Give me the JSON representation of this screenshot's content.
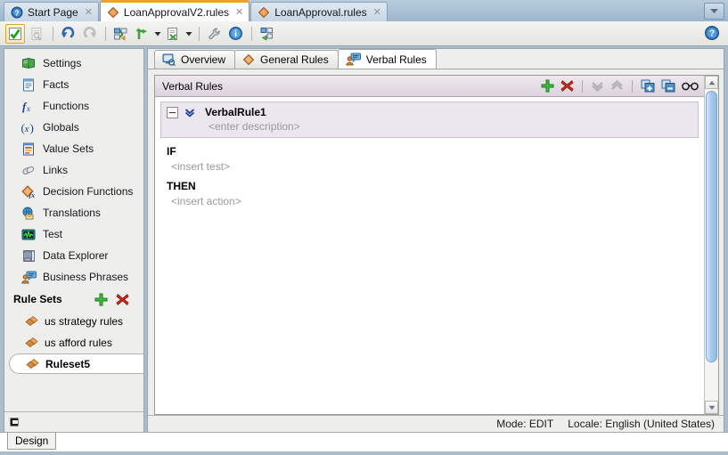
{
  "window": {
    "editor_tabs": [
      {
        "label": "Start Page",
        "icon": "help-circle-icon",
        "active": false,
        "closable": true
      },
      {
        "label": "LoanApprovalV2.rules",
        "icon": "rules-diamond-icon",
        "active": true,
        "closable": true
      },
      {
        "label": "LoanApproval.rules",
        "icon": "rules-diamond-icon",
        "active": false,
        "closable": true
      }
    ],
    "overflow_icon": "chevron-down-icon"
  },
  "toolbar": {
    "buttons": [
      {
        "name": "validate-button",
        "icon": "green-check-icon",
        "selected": true,
        "enabled": true
      },
      {
        "name": "print-preview-button",
        "icon": "document-search-icon",
        "selected": false,
        "enabled": false
      },
      {
        "name": "undo-button",
        "icon": "undo-arrow-icon",
        "selected": false,
        "enabled": true
      },
      {
        "name": "redo-button",
        "icon": "redo-arrow-icon",
        "selected": false,
        "enabled": false
      },
      {
        "name": "dictionary-button",
        "icon": "dictionary-icon",
        "selected": false,
        "enabled": true
      },
      {
        "name": "link-button",
        "icon": "green-branch-icon",
        "selected": false,
        "enabled": true,
        "has_dropdown": true
      },
      {
        "name": "export-button",
        "icon": "document-export-icon",
        "selected": false,
        "enabled": true,
        "has_dropdown": true
      },
      {
        "name": "settings-button",
        "icon": "wrench-icon",
        "selected": false,
        "enabled": true
      },
      {
        "name": "info-button",
        "icon": "info-circle-icon",
        "selected": false,
        "enabled": true
      },
      {
        "name": "goto-button",
        "icon": "green-arrow-dictionary-icon",
        "selected": false,
        "enabled": true
      }
    ],
    "help_icon": "help-circle-icon"
  },
  "sidebar": {
    "nav_items": [
      {
        "label": "Settings",
        "icon": "settings-book-icon"
      },
      {
        "label": "Facts",
        "icon": "facts-document-icon"
      },
      {
        "label": "Functions",
        "icon": "fx-function-icon"
      },
      {
        "label": "Globals",
        "icon": "globals-variable-icon"
      },
      {
        "label": "Value Sets",
        "icon": "value-sets-icon"
      },
      {
        "label": "Links",
        "icon": "links-icon"
      },
      {
        "label": "Decision Functions",
        "icon": "decision-functions-icon"
      },
      {
        "label": "Translations",
        "icon": "translations-icon"
      },
      {
        "label": "Test",
        "icon": "test-monitor-icon"
      },
      {
        "label": "Data Explorer",
        "icon": "data-explorer-icon"
      },
      {
        "label": "Business Phrases",
        "icon": "business-phrases-icon"
      }
    ],
    "rulesets": {
      "header": "Rule Sets",
      "add_icon": "green-plus-icon",
      "delete_icon": "red-x-icon",
      "items": [
        {
          "label": "us strategy rules",
          "icon": "ruleset-diamond-icon",
          "selected": false
        },
        {
          "label": "us afford rules",
          "icon": "ruleset-diamond-icon",
          "selected": false
        },
        {
          "label": "Ruleset5",
          "icon": "ruleset-diamond-icon",
          "selected": true
        }
      ]
    },
    "footer_icon": "collapse-marker-icon"
  },
  "content": {
    "tabs": [
      {
        "label": "Overview",
        "icon": "overview-icon",
        "active": false
      },
      {
        "label": "General Rules",
        "icon": "general-rules-diamond-icon",
        "active": false
      },
      {
        "label": "Verbal Rules",
        "icon": "verbal-rules-icon",
        "active": true
      }
    ],
    "panel": {
      "title": "Verbal Rules",
      "actions": [
        {
          "name": "add-rule-button",
          "icon": "green-plus-icon",
          "enabled": true
        },
        {
          "name": "delete-rule-button",
          "icon": "red-x-icon",
          "enabled": true
        },
        {
          "name": "move-down-button",
          "icon": "chevron-down-icon",
          "enabled": false
        },
        {
          "name": "move-up-button",
          "icon": "chevron-up-icon",
          "enabled": false
        },
        {
          "name": "expand-all-button",
          "icon": "expand-plus-icon",
          "enabled": true
        },
        {
          "name": "collapse-all-button",
          "icon": "collapse-minus-icon",
          "enabled": true
        },
        {
          "name": "show-advanced-button",
          "icon": "glasses-icon",
          "enabled": true
        }
      ],
      "rule": {
        "collapse_icon": "minus-box-icon",
        "options_icon": "double-chevron-down-icon",
        "name": "VerbalRule1",
        "description_placeholder": "<enter description>",
        "if_label": "IF",
        "if_placeholder": "<insert test>",
        "then_label": "THEN",
        "then_placeholder": "<insert action>"
      }
    }
  },
  "statusbar": {
    "mode": "Mode: EDIT",
    "locale": "Locale: English (United States)"
  },
  "bottom_tabs": [
    {
      "label": "Design",
      "active": true
    }
  ],
  "colors": {
    "active_tab_accent": "#f0a02a",
    "window_chrome": "#a8bdd0",
    "panel_header": "#ddd2dd",
    "rule_header_bg": "#ece6ef",
    "placeholder_text": "#9a9a9a",
    "green_accent": "#2aa02a",
    "red_accent": "#cc2222"
  }
}
